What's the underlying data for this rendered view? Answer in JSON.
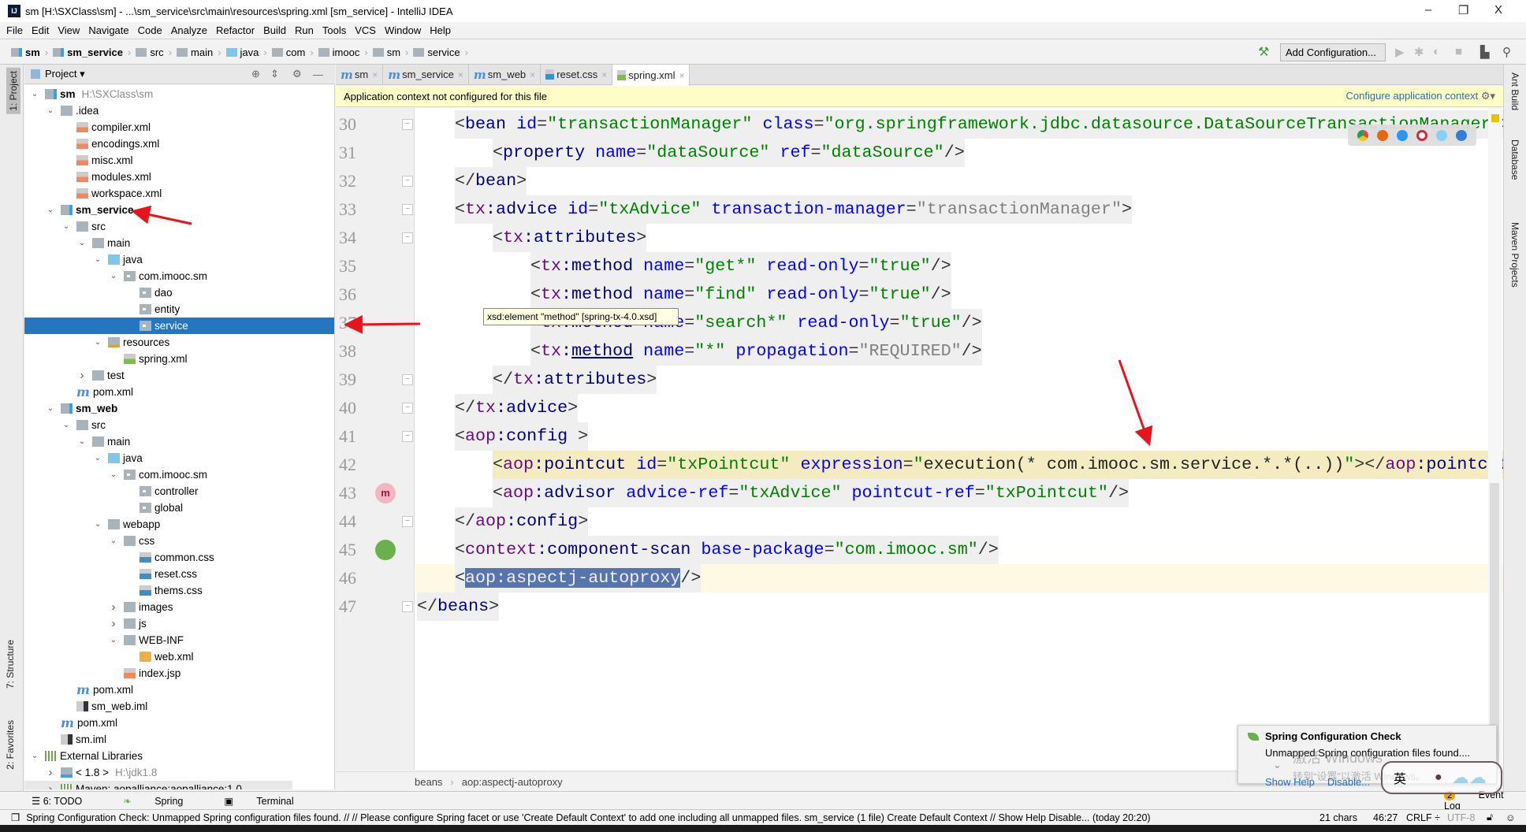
{
  "window": {
    "title": "sm [H:\\SXClass\\sm] - ...\\sm_service\\src\\main\\resources\\spring.xml [sm_service] - IntelliJ IDEA",
    "logo": "IJ",
    "controls": [
      "–",
      "❐",
      "X"
    ]
  },
  "menu": [
    "File",
    "Edit",
    "View",
    "Navigate",
    "Code",
    "Analyze",
    "Refactor",
    "Build",
    "Run",
    "Tools",
    "VCS",
    "Window",
    "Help"
  ],
  "nav": {
    "crumbs": [
      {
        "label": "sm",
        "icon": "mod",
        "bold": true
      },
      {
        "label": "sm_service",
        "icon": "mod",
        "bold": true
      },
      {
        "label": "src",
        "icon": "folder"
      },
      {
        "label": "main",
        "icon": "folder"
      },
      {
        "label": "java",
        "icon": "java"
      },
      {
        "label": "com",
        "icon": "folder"
      },
      {
        "label": "imooc",
        "icon": "folder"
      },
      {
        "label": "sm",
        "icon": "folder"
      },
      {
        "label": "service",
        "icon": "folder"
      }
    ],
    "add_configuration": "Add Configuration..."
  },
  "left_tabs": {
    "project": "1: Project",
    "structure": "7: Structure",
    "favorites": "2: Favorites"
  },
  "right_tabs": {
    "ant": "Ant Build",
    "database": "Database",
    "maven": "Maven Projects"
  },
  "project_panel": {
    "title": "Project ▾",
    "tree": [
      {
        "level": 0,
        "chev": "down",
        "icon": "mod",
        "label": "sm",
        "bold": true,
        "hint": "H:\\SXClass\\sm"
      },
      {
        "level": 1,
        "chev": "down",
        "icon": "folder",
        "label": ".idea"
      },
      {
        "level": 2,
        "icon": "xml",
        "label": "compiler.xml"
      },
      {
        "level": 2,
        "icon": "xml",
        "label": "encodings.xml"
      },
      {
        "level": 2,
        "icon": "xml",
        "label": "misc.xml"
      },
      {
        "level": 2,
        "icon": "xml",
        "label": "modules.xml"
      },
      {
        "level": 2,
        "icon": "xml",
        "label": "workspace.xml"
      },
      {
        "level": 1,
        "chev": "down",
        "icon": "mod",
        "label": "sm_service",
        "bold": true
      },
      {
        "level": 2,
        "chev": "down",
        "icon": "folder",
        "label": "src"
      },
      {
        "level": 3,
        "chev": "down",
        "icon": "folder",
        "label": "main"
      },
      {
        "level": 4,
        "chev": "down",
        "icon": "src",
        "label": "java"
      },
      {
        "level": 5,
        "chev": "down",
        "icon": "pkg",
        "label": "com.imooc.sm"
      },
      {
        "level": 6,
        "icon": "pkg",
        "label": "dao"
      },
      {
        "level": 6,
        "icon": "pkg",
        "label": "entity"
      },
      {
        "level": 6,
        "icon": "pkg",
        "label": "service",
        "selected": true
      },
      {
        "level": 4,
        "chev": "down",
        "icon": "res",
        "label": "resources"
      },
      {
        "level": 5,
        "icon": "sxml",
        "label": "spring.xml"
      },
      {
        "level": 3,
        "chev": "right",
        "icon": "folder",
        "label": "test"
      },
      {
        "level": 2,
        "icon": "maven",
        "label": "pom.xml"
      },
      {
        "level": 1,
        "chev": "down",
        "icon": "mod",
        "label": "sm_web",
        "bold": true
      },
      {
        "level": 2,
        "chev": "down",
        "icon": "folder",
        "label": "src"
      },
      {
        "level": 3,
        "chev": "down",
        "icon": "folder",
        "label": "main"
      },
      {
        "level": 4,
        "chev": "down",
        "icon": "src",
        "label": "java"
      },
      {
        "level": 5,
        "chev": "down",
        "icon": "pkg",
        "label": "com.imooc.sm"
      },
      {
        "level": 6,
        "icon": "pkg",
        "label": "controller"
      },
      {
        "level": 6,
        "icon": "pkg",
        "label": "global"
      },
      {
        "level": 4,
        "chev": "down",
        "icon": "folder",
        "label": "webapp"
      },
      {
        "level": 5,
        "chev": "down",
        "icon": "folder",
        "label": "css"
      },
      {
        "level": 6,
        "icon": "css",
        "label": "common.css"
      },
      {
        "level": 6,
        "icon": "css",
        "label": "reset.css"
      },
      {
        "level": 6,
        "icon": "css",
        "label": "thems.css"
      },
      {
        "level": 5,
        "chev": "right",
        "icon": "folder",
        "label": "images"
      },
      {
        "level": 5,
        "chev": "right",
        "icon": "folder",
        "label": "js"
      },
      {
        "level": 5,
        "chev": "down",
        "icon": "folder",
        "label": "WEB-INF"
      },
      {
        "level": 6,
        "icon": "webxml",
        "label": "web.xml"
      },
      {
        "level": 5,
        "icon": "jsp",
        "label": "index.jsp"
      },
      {
        "level": 2,
        "icon": "maven",
        "label": "pom.xml"
      },
      {
        "level": 2,
        "icon": "iml",
        "label": "sm_web.iml"
      },
      {
        "level": 1,
        "icon": "maven",
        "label": "pom.xml"
      },
      {
        "level": 1,
        "icon": "iml",
        "label": "sm.iml"
      },
      {
        "level": 0,
        "chev": "down",
        "icon": "lib",
        "label": "External Libraries"
      },
      {
        "level": 1,
        "chev": "right",
        "icon": "jdk",
        "label": "< 1.8 >",
        "hint": "H:\\jdk1.8"
      },
      {
        "level": 1,
        "chev": "right",
        "icon": "lib",
        "label": "Maven: aopalliance:aopalliance:1.0",
        "partial": true
      }
    ]
  },
  "tabs": [
    {
      "label": "sm",
      "icon": "maven"
    },
    {
      "label": "sm_service",
      "icon": "maven"
    },
    {
      "label": "sm_web",
      "icon": "maven"
    },
    {
      "label": "reset.css",
      "icon": "css"
    },
    {
      "label": "spring.xml",
      "icon": "xml",
      "active": true
    }
  ],
  "banner": {
    "message": "Application context not configured for this file",
    "action": "Configure application context"
  },
  "editor": {
    "lines": [
      {
        "n": 30,
        "indent": 1,
        "fold": "open",
        "tokens": [
          [
            "<",
            "p"
          ],
          [
            "bean",
            "tg"
          ],
          [
            " ",
            "p"
          ],
          [
            "id",
            "at"
          ],
          [
            "=",
            "p"
          ],
          [
            "\"transactionManager\"",
            "v"
          ],
          [
            " ",
            "p"
          ],
          [
            "class",
            "at"
          ],
          [
            "=",
            "p"
          ],
          [
            "\"org.springframework.jdbc.datasource.DataSourceTransactionManager\"",
            "v"
          ],
          [
            ">",
            "p"
          ]
        ]
      },
      {
        "n": 31,
        "indent": 2,
        "tokens": [
          [
            "<",
            "p"
          ],
          [
            "property",
            "tg"
          ],
          [
            " ",
            "p"
          ],
          [
            "name",
            "at"
          ],
          [
            "=",
            "p"
          ],
          [
            "\"dataSource\"",
            "v"
          ],
          [
            " ",
            "p"
          ],
          [
            "ref",
            "at"
          ],
          [
            "=",
            "p"
          ],
          [
            "\"dataSource\"",
            "v"
          ],
          [
            "/>",
            "p"
          ]
        ]
      },
      {
        "n": 32,
        "indent": 1,
        "fold": "close",
        "tokens": [
          [
            "</",
            "p"
          ],
          [
            "bean",
            "tg"
          ],
          [
            ">",
            "p"
          ]
        ]
      },
      {
        "n": 33,
        "indent": 1,
        "fold": "open",
        "tokens": [
          [
            "<",
            "p"
          ],
          [
            "tx",
            "ns"
          ],
          [
            ":advice",
            "tg"
          ],
          [
            " ",
            "p"
          ],
          [
            "id",
            "at"
          ],
          [
            "=",
            "p"
          ],
          [
            "\"txAdvice\"",
            "v"
          ],
          [
            " ",
            "p"
          ],
          [
            "transaction-manager",
            "at"
          ],
          [
            "=",
            "p"
          ],
          [
            "\"transactionManager\"",
            "g"
          ],
          [
            ">",
            "p"
          ]
        ]
      },
      {
        "n": 34,
        "indent": 2,
        "fold": "open",
        "tokens": [
          [
            "<",
            "p"
          ],
          [
            "tx",
            "ns"
          ],
          [
            ":attributes",
            "tg"
          ],
          [
            ">",
            "p"
          ]
        ]
      },
      {
        "n": 35,
        "indent": 3,
        "tokens": [
          [
            "<",
            "p"
          ],
          [
            "tx",
            "ns"
          ],
          [
            ":method",
            "tg"
          ],
          [
            " ",
            "p"
          ],
          [
            "name",
            "at"
          ],
          [
            "=",
            "p"
          ],
          [
            "\"get*\"",
            "v"
          ],
          [
            " ",
            "p"
          ],
          [
            "read-only",
            "at"
          ],
          [
            "=",
            "p"
          ],
          [
            "\"true\"",
            "v"
          ],
          [
            "/>",
            "p"
          ]
        ]
      },
      {
        "n": 36,
        "indent": 3,
        "tokens": [
          [
            "<",
            "p"
          ],
          [
            "tx",
            "ns"
          ],
          [
            ":method",
            "tg"
          ],
          [
            " ",
            "p"
          ],
          [
            "name",
            "at"
          ],
          [
            "=",
            "p"
          ],
          [
            "\"find\"",
            "v"
          ],
          [
            " ",
            "p"
          ],
          [
            "read-only",
            "at"
          ],
          [
            "=",
            "p"
          ],
          [
            "\"true\"",
            "v"
          ],
          [
            "/>",
            "p"
          ]
        ]
      },
      {
        "n": 37,
        "indent": 3,
        "tokens": [
          [
            "<",
            "p"
          ],
          [
            "tx",
            "ns"
          ],
          [
            ":method",
            "tg"
          ],
          [
            " ",
            "p"
          ],
          [
            "name",
            "at"
          ],
          [
            "=",
            "p"
          ],
          [
            "\"search*\"",
            "v"
          ],
          [
            " ",
            "p"
          ],
          [
            "read-only",
            "at"
          ],
          [
            "=",
            "p"
          ],
          [
            "\"true\"",
            "v"
          ],
          [
            "/>",
            "p"
          ]
        ]
      },
      {
        "n": 38,
        "indent": 3,
        "tokens": [
          [
            "<",
            "p"
          ],
          [
            "tx",
            "ns"
          ],
          [
            ":",
            "tg"
          ],
          [
            "method",
            "u"
          ],
          [
            " ",
            "p"
          ],
          [
            "name",
            "at"
          ],
          [
            "=",
            "p"
          ],
          [
            "\"*\"",
            "v"
          ],
          [
            " ",
            "p"
          ],
          [
            "propagation",
            "at"
          ],
          [
            "=",
            "p"
          ],
          [
            "\"REQUIRED\"",
            "g"
          ],
          [
            "/>",
            "p"
          ]
        ]
      },
      {
        "n": 39,
        "indent": 2,
        "fold": "close",
        "tokens": [
          [
            "</",
            "p"
          ],
          [
            "tx",
            "ns"
          ],
          [
            ":attributes",
            "tg"
          ],
          [
            ">",
            "p"
          ]
        ]
      },
      {
        "n": 40,
        "indent": 1,
        "fold": "close",
        "tokens": [
          [
            "</",
            "p"
          ],
          [
            "tx",
            "ns"
          ],
          [
            ":advice",
            "tg"
          ],
          [
            ">",
            "p"
          ]
        ]
      },
      {
        "n": 41,
        "indent": 1,
        "fold": "open",
        "tokens": [
          [
            "<",
            "p"
          ],
          [
            "aop",
            "ns"
          ],
          [
            ":config",
            "tg"
          ],
          [
            " >",
            "p"
          ]
        ]
      },
      {
        "n": 42,
        "indent": 2,
        "highlight": true,
        "tokens": [
          [
            "<",
            "p"
          ],
          [
            "aop",
            "ns"
          ],
          [
            ":pointcut",
            "tg"
          ],
          [
            " ",
            "p"
          ],
          [
            "id",
            "at"
          ],
          [
            "=",
            "p"
          ],
          [
            "\"txPointcut\"",
            "v"
          ],
          [
            " ",
            "p"
          ],
          [
            "expression",
            "at"
          ],
          [
            "=",
            "p"
          ],
          [
            "\"",
            "v"
          ],
          [
            "execution(* com.imooc.sm.service.*.*(..))",
            "d"
          ],
          [
            "\"",
            "v"
          ],
          [
            "></",
            "p"
          ],
          [
            "aop",
            "ns"
          ],
          [
            ":pointcut",
            "tg"
          ],
          [
            ">",
            "p"
          ]
        ]
      },
      {
        "n": 43,
        "indent": 2,
        "gutter_icon": "aop-advisor-icon",
        "tokens": [
          [
            "<",
            "p"
          ],
          [
            "aop",
            "ns"
          ],
          [
            ":advisor",
            "tg"
          ],
          [
            " ",
            "p"
          ],
          [
            "advice-ref",
            "at"
          ],
          [
            "=",
            "p"
          ],
          [
            "\"txAdvice\"",
            "v"
          ],
          [
            " ",
            "p"
          ],
          [
            "pointcut-ref",
            "at"
          ],
          [
            "=",
            "p"
          ],
          [
            "\"txPointcut\"",
            "v"
          ],
          [
            "/>",
            "p"
          ]
        ]
      },
      {
        "n": 44,
        "indent": 1,
        "fold": "close",
        "tokens": [
          [
            "</",
            "p"
          ],
          [
            "aop",
            "ns"
          ],
          [
            ":config",
            "tg"
          ],
          [
            ">",
            "p"
          ]
        ]
      },
      {
        "n": 45,
        "indent": 1,
        "gutter_icon": "spring-scan-icon",
        "tokens": [
          [
            "<",
            "p"
          ],
          [
            "context",
            "ns"
          ],
          [
            ":component-scan",
            "tg"
          ],
          [
            " ",
            "p"
          ],
          [
            "base-package",
            "at"
          ],
          [
            "=",
            "p"
          ],
          [
            "\"com.imooc.sm\"",
            "v"
          ],
          [
            "/>",
            "p"
          ]
        ]
      },
      {
        "n": 46,
        "indent": 1,
        "caret": true,
        "tokens": [
          [
            "<",
            "p"
          ],
          [
            "aop:aspectj-autoproxy",
            "sel"
          ],
          [
            "/>",
            "p"
          ]
        ]
      },
      {
        "n": 47,
        "indent": 0,
        "fold": "close",
        "tokens": [
          [
            "</",
            "p"
          ],
          [
            "beans",
            "tg"
          ],
          [
            ">",
            "p"
          ]
        ]
      }
    ],
    "tooltip": "xsd:element \"method\" [spring-tx-4.0.xsd]",
    "breadcrumb": [
      "beans",
      "aop:aspectj-autoproxy"
    ],
    "colors": {
      "tag": "#000080",
      "namespace": "#660e7a",
      "attribute": "#0000ff",
      "value": "#008000",
      "selection": "#5674ad"
    }
  },
  "tool_windows": {
    "todo": "6: TODO",
    "spring": "Spring",
    "terminal": "Terminal",
    "event_log": "Event Log",
    "event_count": "2"
  },
  "notification": {
    "title": "Spring Configuration Check",
    "body": "Unmapped Spring configuration files found....",
    "show_help": "Show Help",
    "disable": "Disable..."
  },
  "watermark": {
    "line1": "激活 Windows",
    "line2": "转到“设置”以激活 Windows。"
  },
  "ime": {
    "label": "英"
  },
  "status": {
    "message": "Spring Configuration Check: Unmapped Spring configuration files found. // // Please configure Spring facet or use 'Create Default Context' to add one including all unmapped files. sm_service (1 file)   Create Default Context // Show Help Disable... (today 20:20)",
    "chars": "21 chars",
    "position": "46:27",
    "line_sep": "CRLF ÷",
    "encoding": "UTF-8"
  },
  "annotation_color": "#e8141c"
}
